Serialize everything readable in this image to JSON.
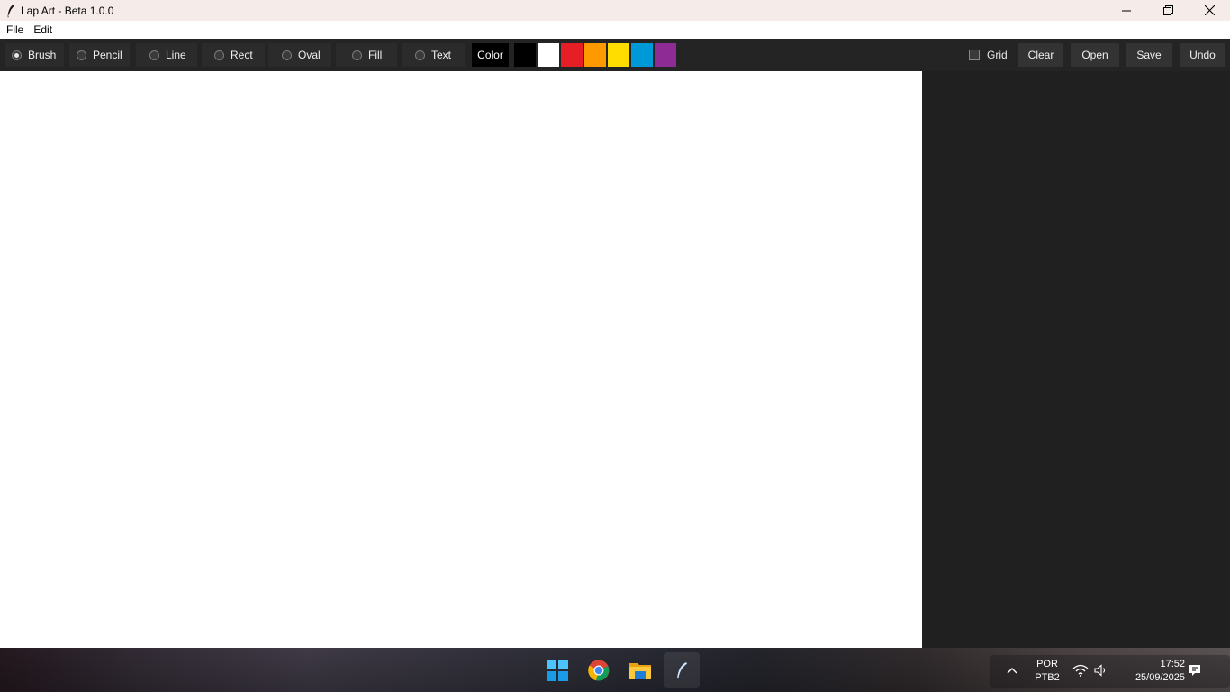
{
  "window": {
    "title": "Lap Art - Beta 1.0.0",
    "icons": {
      "app": "feather-icon",
      "minimize": "minimize-icon",
      "maximize": "restore-icon",
      "close": "close-icon"
    }
  },
  "menu": {
    "items": [
      "File",
      "Edit"
    ]
  },
  "toolbar": {
    "tools": [
      {
        "label": "Brush",
        "selected": true
      },
      {
        "label": "Pencil",
        "selected": false
      },
      {
        "label": "Line",
        "selected": false
      },
      {
        "label": "Rect",
        "selected": false
      },
      {
        "label": "Oval",
        "selected": false
      },
      {
        "label": "Fill",
        "selected": false
      },
      {
        "label": "Text",
        "selected": false
      }
    ],
    "color_label": "Color",
    "palette": [
      "#000000",
      "#ffffff",
      "#e61e25",
      "#ff9900",
      "#ffdd00",
      "#0099d8",
      "#8e2b94"
    ],
    "grid_label": "Grid",
    "grid_checked": false,
    "actions": [
      "Clear",
      "Open",
      "Save",
      "Undo"
    ]
  },
  "canvas": {
    "background": "#ffffff"
  },
  "side_panel": {
    "background": "#202020"
  },
  "taskbar": {
    "apps": [
      "windows-start-icon",
      "chrome-icon",
      "file-explorer-icon",
      "lap-art-feather-icon"
    ],
    "language_line1": "POR",
    "language_line2": "PTB2",
    "time": "17:52",
    "date": "25/09/2025",
    "tray_icons": [
      "chevron-up-icon",
      "wifi-icon",
      "volume-icon",
      "notification-icon"
    ]
  }
}
